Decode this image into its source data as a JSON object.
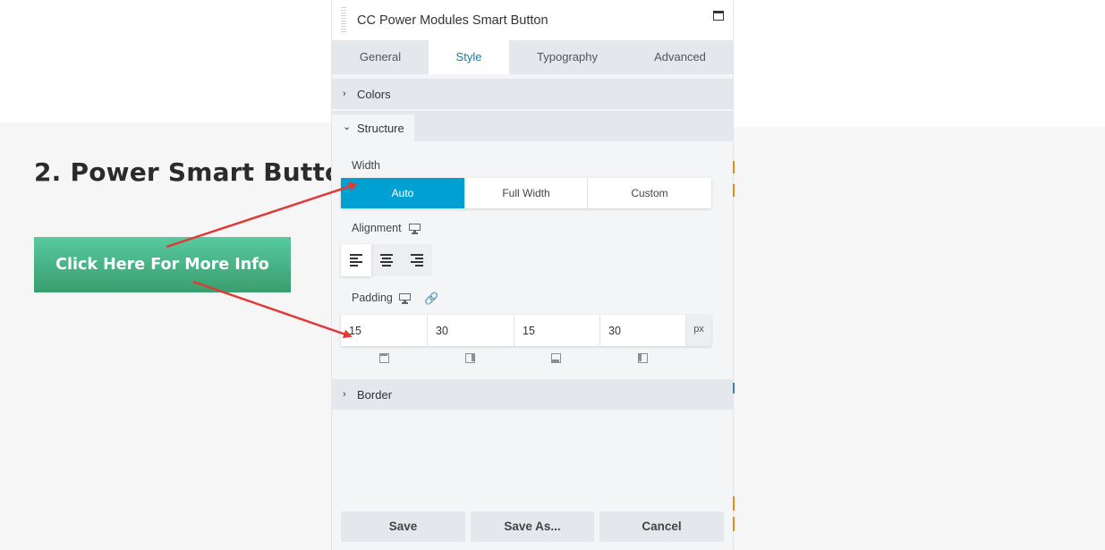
{
  "page": {
    "heading": "2. Power Smart Butto",
    "smart_button_label": "Click Here For More Info"
  },
  "panel": {
    "title": "CC Power Modules Smart Button",
    "tabs": [
      {
        "label": "General"
      },
      {
        "label": "Style"
      },
      {
        "label": "Typography"
      },
      {
        "label": "Advanced"
      }
    ],
    "active_tab": "Style",
    "sections": {
      "colors": "Colors",
      "structure": "Structure",
      "border": "Border"
    },
    "width": {
      "label": "Width",
      "options": [
        "Auto",
        "Full Width",
        "Custom"
      ],
      "selected": "Auto"
    },
    "alignment": {
      "label": "Alignment",
      "selected": "left"
    },
    "padding": {
      "label": "Padding",
      "values": [
        "15",
        "30",
        "15",
        "30"
      ],
      "unit": "px"
    },
    "footer": {
      "save": "Save",
      "save_as": "Save As...",
      "cancel": "Cancel"
    }
  },
  "colors": {
    "accent": "#00a0d2",
    "active_tab_text": "#0e7fa8",
    "button_gradient_top": "#58c99f",
    "button_gradient_bottom": "#3a9e6e",
    "annotation_arrow": "#e03a36"
  }
}
